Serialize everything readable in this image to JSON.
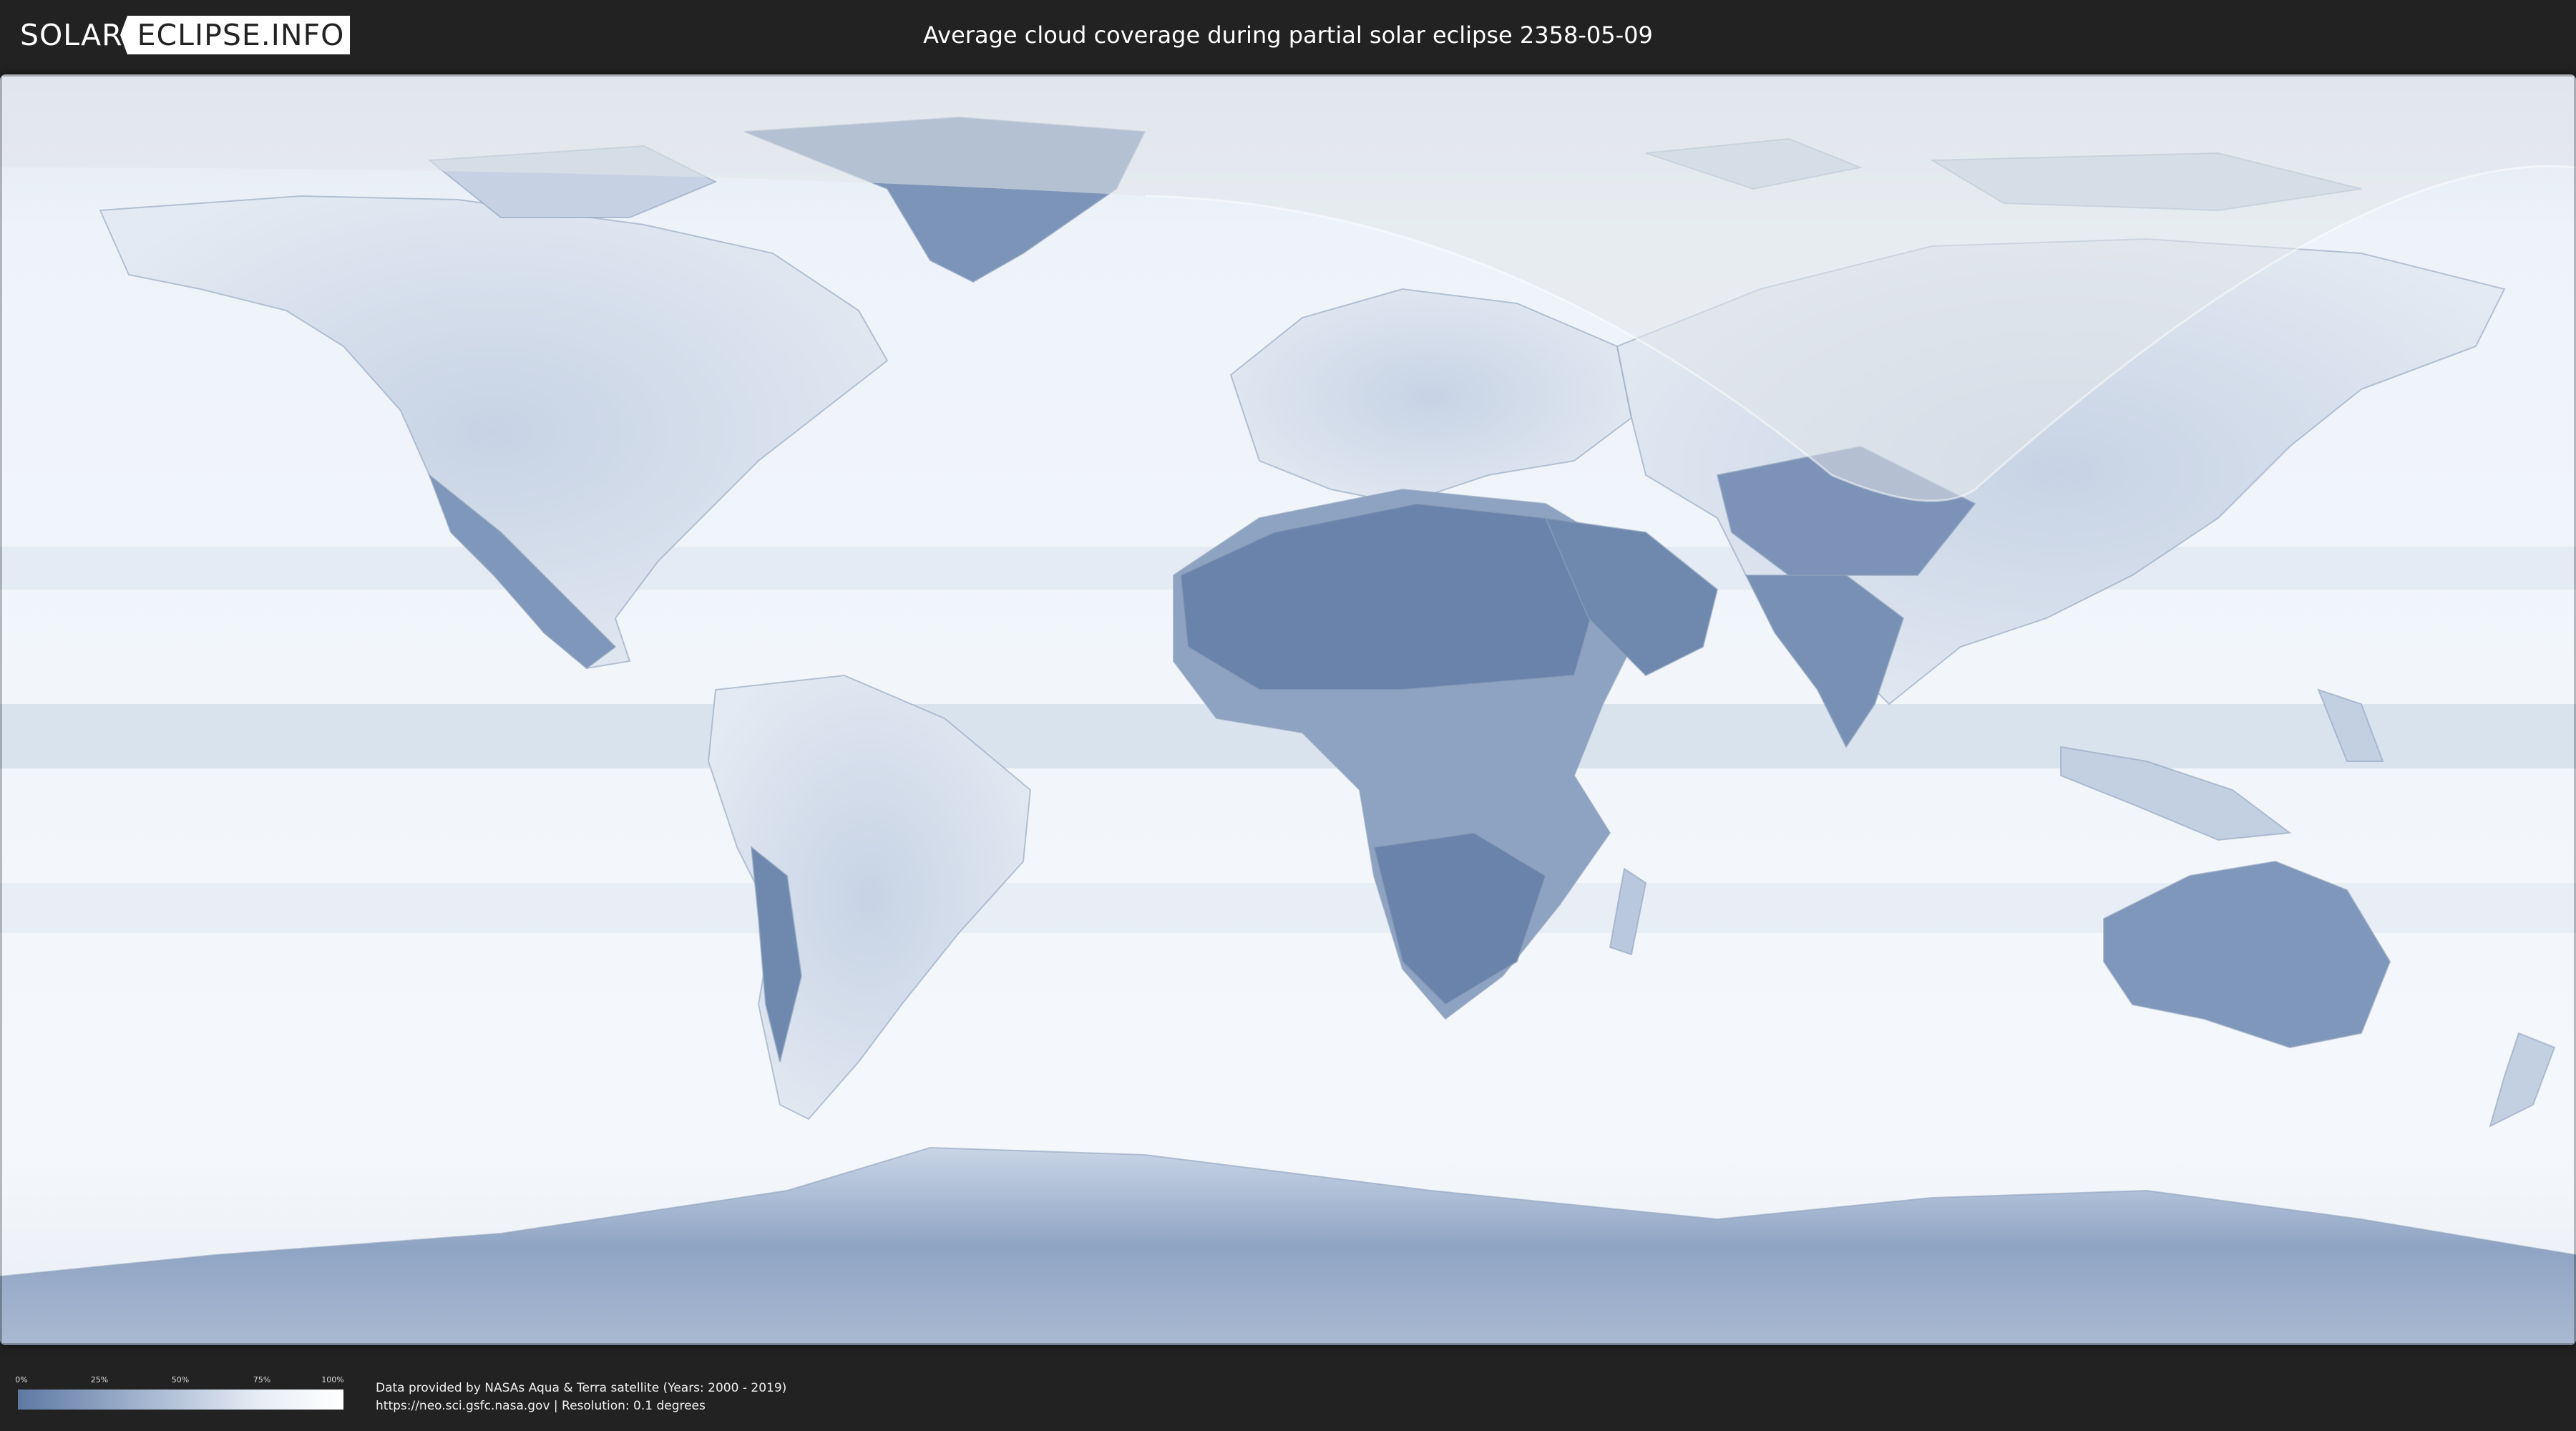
{
  "header": {
    "logo_part1": "SOLAR",
    "logo_part2": "ECLIPSE.INFO",
    "title": "Average cloud coverage during partial solar eclipse 2358-05-09"
  },
  "legend": {
    "ticks": [
      "0%",
      "25%",
      "50%",
      "75%",
      "100%"
    ],
    "gradient_colors": [
      "#5d79a3",
      "#a6b7d1",
      "#e8eef6",
      "#ffffff"
    ]
  },
  "credits": {
    "line1": "Data provided by NASAs Aqua & Terra satellite (Years: 2000 - 2019)",
    "line2": "https://neo.sci.gsfc.nasa.gov | Resolution: 0.1 degrees"
  },
  "map": {
    "ocean_color": "#eef3fa",
    "land_clear_color": "#6d86ad",
    "eclipse_zone_color": "#e2e5ea"
  }
}
